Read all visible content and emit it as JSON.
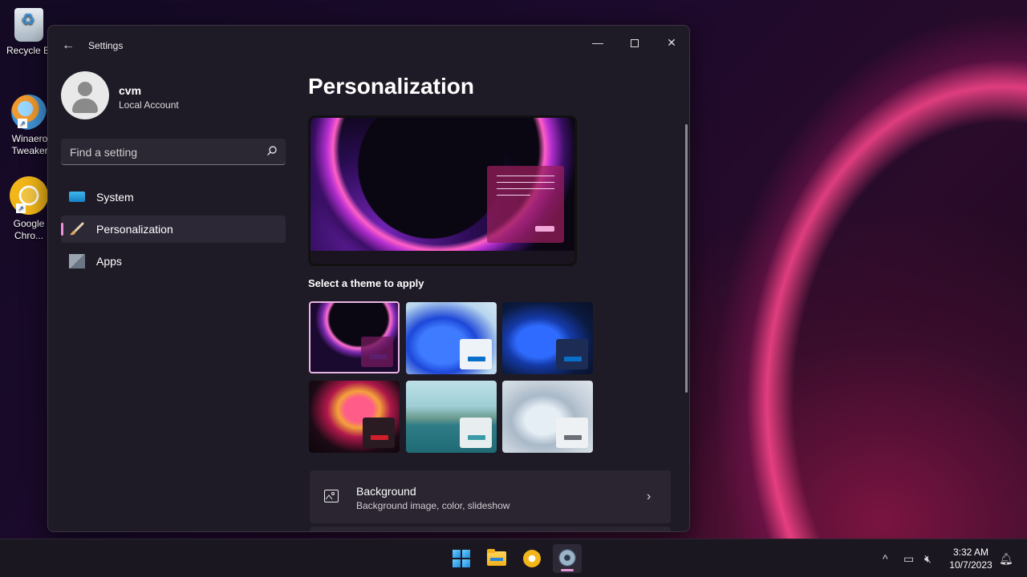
{
  "desktop": {
    "icons": [
      {
        "label": "Recycle Bin"
      },
      {
        "label": "Winaero Tweaker"
      },
      {
        "label": "Google Chro..."
      }
    ]
  },
  "window": {
    "title": "Settings",
    "controls": {
      "minimize": "—",
      "close": "✕"
    }
  },
  "account": {
    "name": "cvm",
    "type": "Local Account"
  },
  "search": {
    "placeholder": "Find a setting"
  },
  "nav": {
    "items": [
      {
        "label": "System",
        "icon": "monitor-icon"
      },
      {
        "label": "Personalization",
        "icon": "brush-icon",
        "active": true
      },
      {
        "label": "Apps",
        "icon": "apps-icon"
      }
    ]
  },
  "main": {
    "title": "Personalization",
    "themes_label": "Select a theme to apply",
    "theme_chip_colors": [
      "#5b1f6e",
      "#0a6fc8",
      "#0a6fc8",
      "#d21d2a",
      "#3a9aa6",
      "#6a6e76"
    ],
    "cards": [
      {
        "title": "Background",
        "subtitle": "Background image, color, slideshow",
        "icon": "image-icon"
      }
    ]
  },
  "taskbar": {
    "apps": [
      "start-icon",
      "file-explorer-icon",
      "chrome-icon",
      "settings-icon"
    ],
    "clock": {
      "time": "3:32 AM",
      "date": "10/7/2023"
    }
  },
  "colors": {
    "accent": "#e994d6",
    "window_bg": "#1f1b26",
    "card_bg": "#2a2530"
  }
}
